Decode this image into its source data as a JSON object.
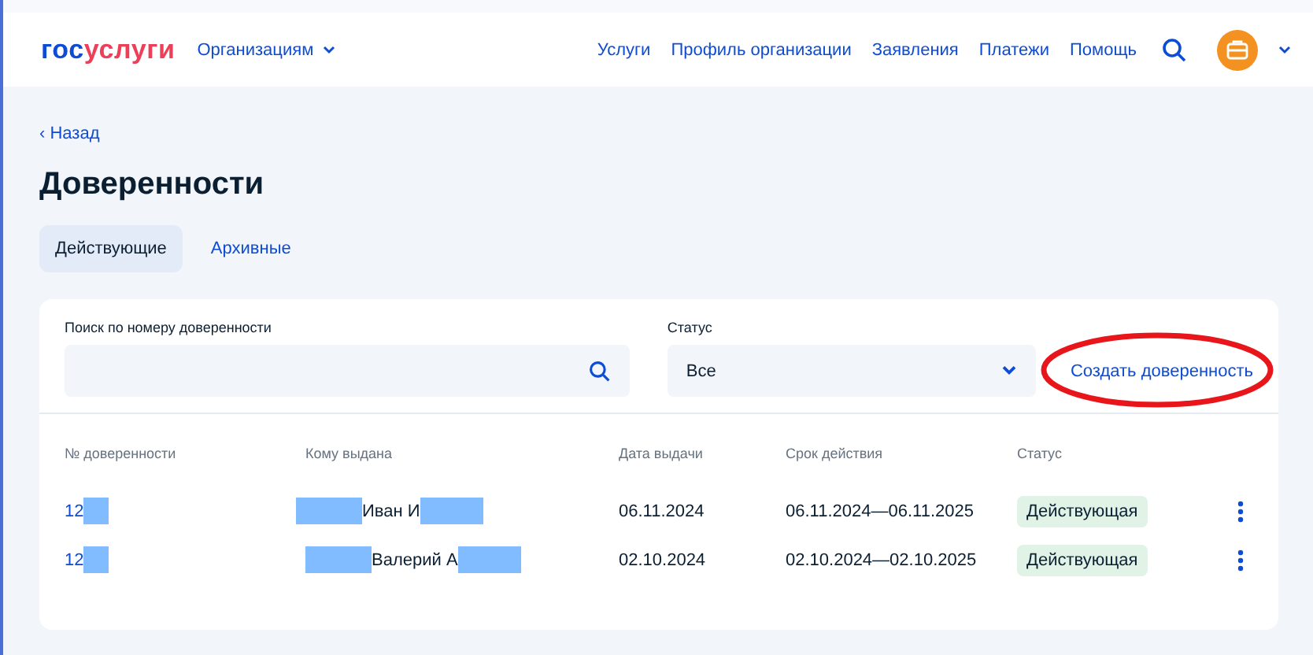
{
  "header": {
    "logo": {
      "part_1": "гос",
      "part_2": "услуги"
    },
    "menu": "Организациям",
    "nav": [
      "Услуги",
      "Профиль организации",
      "Заявления",
      "Платежи",
      "Помощь"
    ]
  },
  "back": "‹ Назад",
  "title": "Доверенности",
  "tabs": [
    {
      "label": "Действующие",
      "selected": true
    },
    {
      "label": "Архивные",
      "selected": false
    }
  ],
  "filters": {
    "search_label": "Поиск по номеру доверенности",
    "status_label": "Статус",
    "status_value": "Все",
    "create_link": "Создать доверенность"
  },
  "table": {
    "columns": [
      "№ доверенности",
      "Кому выдана",
      "Дата выдачи",
      "Срок действия",
      "Статус"
    ],
    "rows": [
      {
        "number": "12",
        "recipient": "Иван И",
        "issued": "06.11.2024",
        "validity": "06.11.2024—06.11.2025",
        "status": "Действующая"
      },
      {
        "number": "12",
        "recipient": "Валерий А",
        "issued": "02.10.2024",
        "validity": "02.10.2024—02.10.2025",
        "status": "Действующая"
      }
    ]
  }
}
